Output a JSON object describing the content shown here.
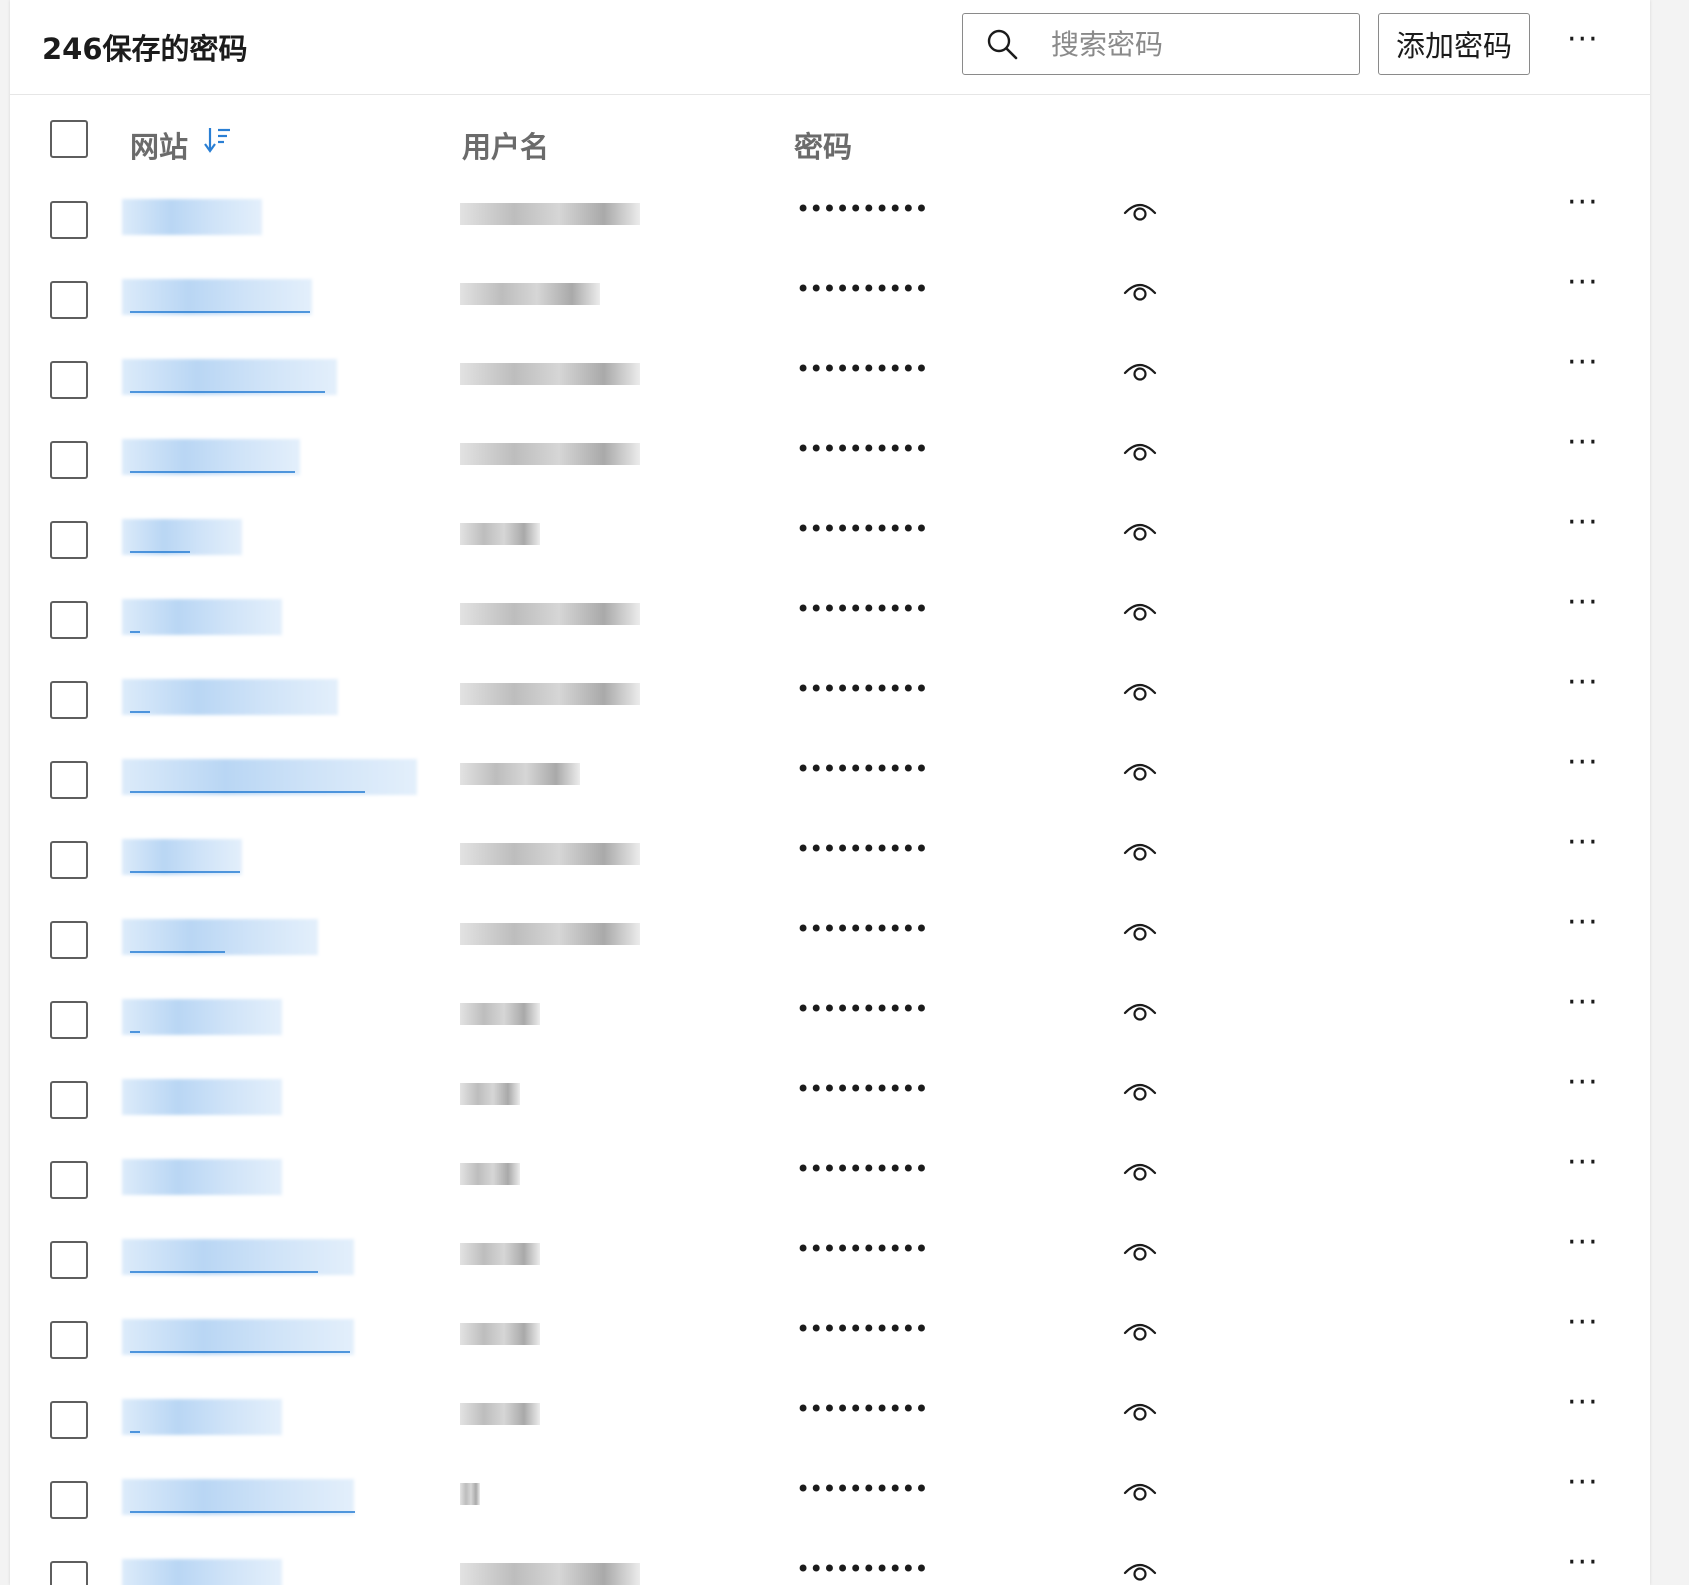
{
  "header": {
    "title": "246保存的密码",
    "search_placeholder": "搜索密码",
    "add_button": "添加密码",
    "more": "···"
  },
  "columns": {
    "website": "网站",
    "username": "用户名",
    "password": "密码"
  },
  "icons": [
    "search-icon",
    "sort-descending-icon",
    "eye-icon",
    "more-icon"
  ],
  "colors": {
    "link": "#2a7fd4",
    "border": "#8a8a8a",
    "header_text": "#6b6b6b"
  },
  "rows": [
    {
      "site": "██████",
      "user": "██████",
      "password": "••••••••••"
    },
    {
      "site": "██████",
      "user": "██████",
      "password": "••••••••••"
    },
    {
      "site": "██████",
      "user": "██████",
      "password": "••••••••••"
    },
    {
      "site": "██████",
      "user": "██████",
      "password": "••••••••••"
    },
    {
      "site": "██████",
      "user": "██████",
      "password": "••••••••••"
    },
    {
      "site": "██████",
      "user": "██████",
      "password": "••••••••••"
    },
    {
      "site": "██████",
      "user": "██████",
      "password": "••••••••••"
    },
    {
      "site": "██████",
      "user": "██████",
      "password": "••••••••••"
    },
    {
      "site": "██████",
      "user": "██████",
      "password": "••••••••••"
    },
    {
      "site": "██████",
      "user": "██████",
      "password": "••••••••••"
    },
    {
      "site": "██████",
      "user": "██████",
      "password": "••••••••••"
    },
    {
      "site": "██████",
      "user": "██████",
      "password": "••••••••••"
    },
    {
      "site": "██████",
      "user": "██████",
      "password": "••••••••••"
    },
    {
      "site": "██████",
      "user": "██████",
      "password": "••••••••••"
    },
    {
      "site": "██████",
      "user": "██████",
      "password": "••••••••••"
    },
    {
      "site": "██████",
      "user": "██████",
      "password": "••••••••••"
    },
    {
      "site": "██████",
      "user": "██████",
      "password": "••••••••••"
    },
    {
      "site": "██████",
      "user": "██████",
      "password": "••••••••••"
    }
  ]
}
